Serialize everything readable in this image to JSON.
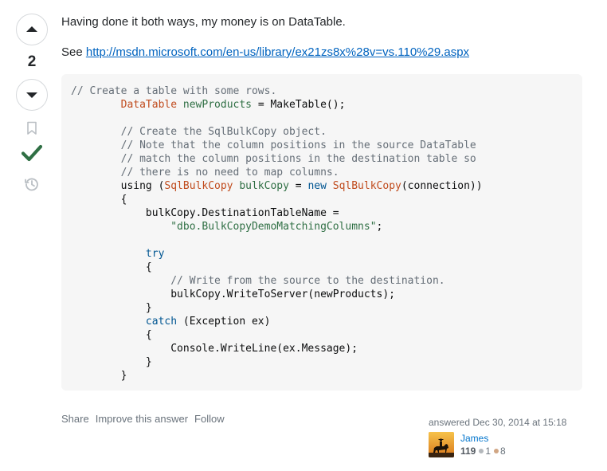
{
  "vote": {
    "count": "2",
    "accepted_color": "#2f6f44",
    "icons": [
      "arrow-up-icon",
      "arrow-down-icon",
      "bookmark-icon",
      "accepted-check-icon",
      "history-icon"
    ]
  },
  "post": {
    "paragraph1": "Having done it both ways, my money is on DataTable.",
    "see_label": "See ",
    "link_text": "http://msdn.microsoft.com/en-us/library/ex21zs8x%28v=vs.110%29.aspx",
    "link_href": "http://msdn.microsoft.com/en-us/library/ex21zs8x%28v=vs.110%29.aspx"
  },
  "code_lines": [
    [
      [
        "c",
        "// Create a table with some rows."
      ]
    ],
    [
      [
        "",
        "        "
      ],
      [
        "t",
        "DataTable"
      ],
      [
        "",
        " "
      ],
      [
        "v",
        "newProducts"
      ],
      [
        "",
        " = MakeTable();"
      ]
    ],
    [
      [
        "",
        ""
      ]
    ],
    [
      [
        "",
        "        "
      ],
      [
        "c",
        "// Create the SqlBulkCopy object."
      ]
    ],
    [
      [
        "",
        "        "
      ],
      [
        "c",
        "// Note that the column positions in the source DataTable"
      ]
    ],
    [
      [
        "",
        "        "
      ],
      [
        "c",
        "// match the column positions in the destination table so"
      ]
    ],
    [
      [
        "",
        "        "
      ],
      [
        "c",
        "// there is no need to map columns."
      ]
    ],
    [
      [
        "",
        "        using ("
      ],
      [
        "t",
        "SqlBulkCopy"
      ],
      [
        "",
        " "
      ],
      [
        "v",
        "bulkCopy"
      ],
      [
        "",
        " = "
      ],
      [
        "k",
        "new"
      ],
      [
        "",
        " "
      ],
      [
        "t",
        "SqlBulkCopy"
      ],
      [
        "",
        "(connection))"
      ]
    ],
    [
      [
        "",
        "        {"
      ]
    ],
    [
      [
        "",
        "            bulkCopy.DestinationTableName ="
      ]
    ],
    [
      [
        "",
        "                "
      ],
      [
        "s",
        "\"dbo.BulkCopyDemoMatchingColumns\""
      ],
      [
        "",
        ";"
      ]
    ],
    [
      [
        "",
        ""
      ]
    ],
    [
      [
        "",
        "            "
      ],
      [
        "k",
        "try"
      ]
    ],
    [
      [
        "",
        "            {"
      ]
    ],
    [
      [
        "",
        "                "
      ],
      [
        "c",
        "// Write from the source to the destination."
      ]
    ],
    [
      [
        "",
        "                bulkCopy.WriteToServer(newProducts);"
      ]
    ],
    [
      [
        "",
        "            }"
      ]
    ],
    [
      [
        "",
        "            "
      ],
      [
        "k",
        "catch"
      ],
      [
        "",
        " (Exception ex)"
      ]
    ],
    [
      [
        "",
        "            {"
      ]
    ],
    [
      [
        "",
        "                Console.WriteLine(ex.Message);"
      ]
    ],
    [
      [
        "",
        "            }"
      ]
    ],
    [
      [
        "",
        "        }"
      ]
    ]
  ],
  "actions": {
    "share": "Share",
    "improve": "Improve this answer",
    "follow": "Follow"
  },
  "signature": {
    "answered": "answered Dec 30, 2014 at 15:18",
    "user_name": "James",
    "reputation": "119",
    "silver": "1",
    "bronze": "8"
  }
}
